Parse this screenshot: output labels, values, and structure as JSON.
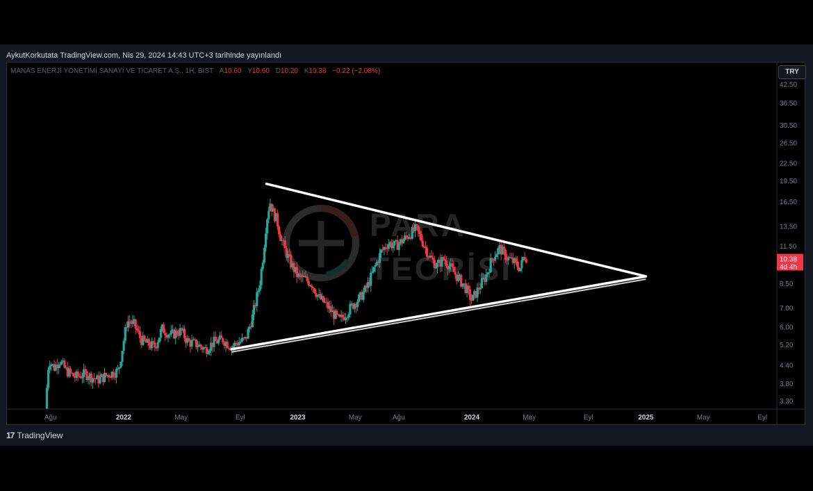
{
  "publisher_line": "AykutKorkutata TradingView.com, Nis 29, 2024 14:43 UTC+3 tarihinde yayınlandı",
  "legend": {
    "symbol": "MANAS ENERJİ YÖNETİMİ SANAYİ VE TİCARET A.Ş., 1H, BIST",
    "open_label": "A",
    "open_value": "10.60",
    "high_label": "Y",
    "high_value": "10.60",
    "low_label": "D",
    "low_value": "10.20",
    "close_label": "K",
    "close_value": "10.38",
    "change": "−0.22 (−2.08%)"
  },
  "currency": "TRY",
  "last_price": "10.38",
  "countdown": "4d 4h",
  "watermark": {
    "line1": "PARA",
    "line2": "TEORİSİ"
  },
  "footer": {
    "brand": "TradingView"
  },
  "colors": {
    "up": "#26a69a",
    "down": "#f23645",
    "background": "#000000",
    "trendline": "#ffffff"
  },
  "chart_data": {
    "type": "candlestick",
    "y_scale": "log",
    "ylim": [
      3.0,
      46.0
    ],
    "y_ticks": [
      "42.50",
      "36.50",
      "30.50",
      "26.50",
      "22.50",
      "19.50",
      "16.50",
      "13.50",
      "11.50",
      "10.38",
      "8.50",
      "7.00",
      "6.00",
      "5.20",
      "4.40",
      "3.80",
      "3.30"
    ],
    "x_ticks": [
      {
        "label": "Ağu",
        "t": 2021.58,
        "bold": false
      },
      {
        "label": "2022",
        "t": 2022.0,
        "bold": true
      },
      {
        "label": "May",
        "t": 2022.33,
        "bold": false
      },
      {
        "label": "Eyl",
        "t": 2022.67,
        "bold": false
      },
      {
        "label": "2023",
        "t": 2023.0,
        "bold": true
      },
      {
        "label": "May",
        "t": 2023.33,
        "bold": false
      },
      {
        "label": "Ağu",
        "t": 2023.58,
        "bold": false
      },
      {
        "label": "2024",
        "t": 2024.0,
        "bold": true
      },
      {
        "label": "May",
        "t": 2024.33,
        "bold": false
      },
      {
        "label": "Eyl",
        "t": 2024.67,
        "bold": false
      },
      {
        "label": "2025",
        "t": 2025.0,
        "bold": true
      },
      {
        "label": "May",
        "t": 2025.33,
        "bold": false
      },
      {
        "label": "Eyl",
        "t": 2025.67,
        "bold": false
      }
    ],
    "close_path": [
      [
        2021.55,
        3.1
      ],
      [
        2021.57,
        4.6
      ],
      [
        2021.6,
        4.3
      ],
      [
        2021.63,
        4.6
      ],
      [
        2021.67,
        4.2
      ],
      [
        2021.72,
        4.0
      ],
      [
        2021.78,
        4.1
      ],
      [
        2021.85,
        3.9
      ],
      [
        2021.92,
        4.1
      ],
      [
        2021.97,
        4.2
      ],
      [
        2022.02,
        6.3
      ],
      [
        2022.06,
        6.1
      ],
      [
        2022.1,
        5.4
      ],
      [
        2022.14,
        5.2
      ],
      [
        2022.18,
        5.1
      ],
      [
        2022.22,
        5.9
      ],
      [
        2022.27,
        5.6
      ],
      [
        2022.33,
        5.8
      ],
      [
        2022.37,
        5.3
      ],
      [
        2022.42,
        5.2
      ],
      [
        2022.47,
        5.0
      ],
      [
        2022.52,
        5.3
      ],
      [
        2022.57,
        5.4
      ],
      [
        2022.62,
        5.1
      ],
      [
        2022.66,
        5.3
      ],
      [
        2022.7,
        5.4
      ],
      [
        2022.74,
        6.5
      ],
      [
        2022.78,
        8.4
      ],
      [
        2022.8,
        10.5
      ],
      [
        2022.82,
        14.0
      ],
      [
        2022.84,
        16.5
      ],
      [
        2022.86,
        15.0
      ],
      [
        2022.88,
        14.2
      ],
      [
        2022.9,
        12.5
      ],
      [
        2022.93,
        11.0
      ],
      [
        2022.96,
        10.0
      ],
      [
        2023.0,
        9.0
      ],
      [
        2023.04,
        8.8
      ],
      [
        2023.08,
        8.5
      ],
      [
        2023.12,
        7.6
      ],
      [
        2023.16,
        7.2
      ],
      [
        2023.2,
        6.7
      ],
      [
        2023.24,
        6.3
      ],
      [
        2023.28,
        6.7
      ],
      [
        2023.32,
        7.2
      ],
      [
        2023.36,
        7.6
      ],
      [
        2023.4,
        8.3
      ],
      [
        2023.44,
        9.6
      ],
      [
        2023.48,
        11.0
      ],
      [
        2023.52,
        11.8
      ],
      [
        2023.56,
        11.5
      ],
      [
        2023.6,
        12.0
      ],
      [
        2023.64,
        12.6
      ],
      [
        2023.68,
        13.2
      ],
      [
        2023.72,
        11.8
      ],
      [
        2023.76,
        10.5
      ],
      [
        2023.8,
        9.8
      ],
      [
        2023.84,
        10.4
      ],
      [
        2023.88,
        9.6
      ],
      [
        2023.92,
        8.9
      ],
      [
        2023.96,
        8.3
      ],
      [
        2024.0,
        7.4
      ],
      [
        2024.04,
        8.2
      ],
      [
        2024.08,
        9.0
      ],
      [
        2024.12,
        10.5
      ],
      [
        2024.16,
        11.3
      ],
      [
        2024.2,
        10.5
      ],
      [
        2024.24,
        10.1
      ],
      [
        2024.28,
        9.6
      ],
      [
        2024.3,
        10.7
      ],
      [
        2024.32,
        10.38
      ]
    ],
    "trendlines": [
      {
        "name": "upper",
        "from": [
          2022.82,
          19.0
        ],
        "to": [
          2025.0,
          9.0
        ]
      },
      {
        "name": "lower",
        "from": [
          2022.62,
          5.0
        ],
        "to": [
          2025.0,
          9.0
        ]
      }
    ]
  }
}
